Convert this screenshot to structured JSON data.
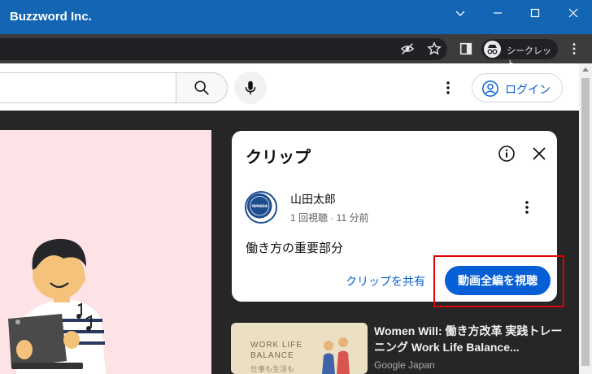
{
  "window": {
    "title": "Buzzword Inc."
  },
  "browser": {
    "incognito_label": "シークレット"
  },
  "header": {
    "login_label": "ログイン"
  },
  "clip_panel": {
    "heading": "クリップ",
    "channel_name": "山田太郎",
    "channel_avatar_text": "YAMADA",
    "meta": "1 回視聴 · 11 分前",
    "clip_title": "働き方の重要部分",
    "share_label": "クリップを共有",
    "full_video_label": "動画全編を視聴"
  },
  "related": {
    "title": "Women Will: 働き方改革 実践トレーニング Work Life Balance...",
    "channel": "Google Japan",
    "thumb_line1": "WORK LIFE",
    "thumb_line2": "BALANCE",
    "thumb_line3": "仕事も生活も"
  },
  "colors": {
    "accent": "#065fd4",
    "titlebar": "#1466b4",
    "highlight": "#e00000"
  }
}
